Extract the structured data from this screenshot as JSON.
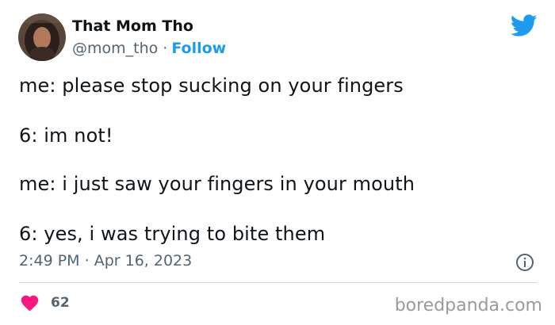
{
  "author": {
    "display_name": "That Mom Tho",
    "handle": "@mom_tho",
    "separator": "·",
    "follow_label": "Follow"
  },
  "tweet": {
    "lines": [
      "me: please stop sucking on your fingers",
      "6: im not!",
      "me: i just saw your fingers in your mouth",
      "6: yes, i was trying to bite them"
    ],
    "time": "2:49 PM",
    "separator": "·",
    "date": "Apr 16, 2023"
  },
  "engagement": {
    "like_count": "62"
  },
  "watermark": {
    "text": "boredpanda.com"
  },
  "icons": {
    "brand": "twitter-bird-icon",
    "info": "info-icon",
    "like": "heart-icon"
  },
  "colors": {
    "text": "#0f1419",
    "secondary": "#536471",
    "accent": "#1d9bf0",
    "heart": "#f91880",
    "divider": "#cfd9de"
  }
}
